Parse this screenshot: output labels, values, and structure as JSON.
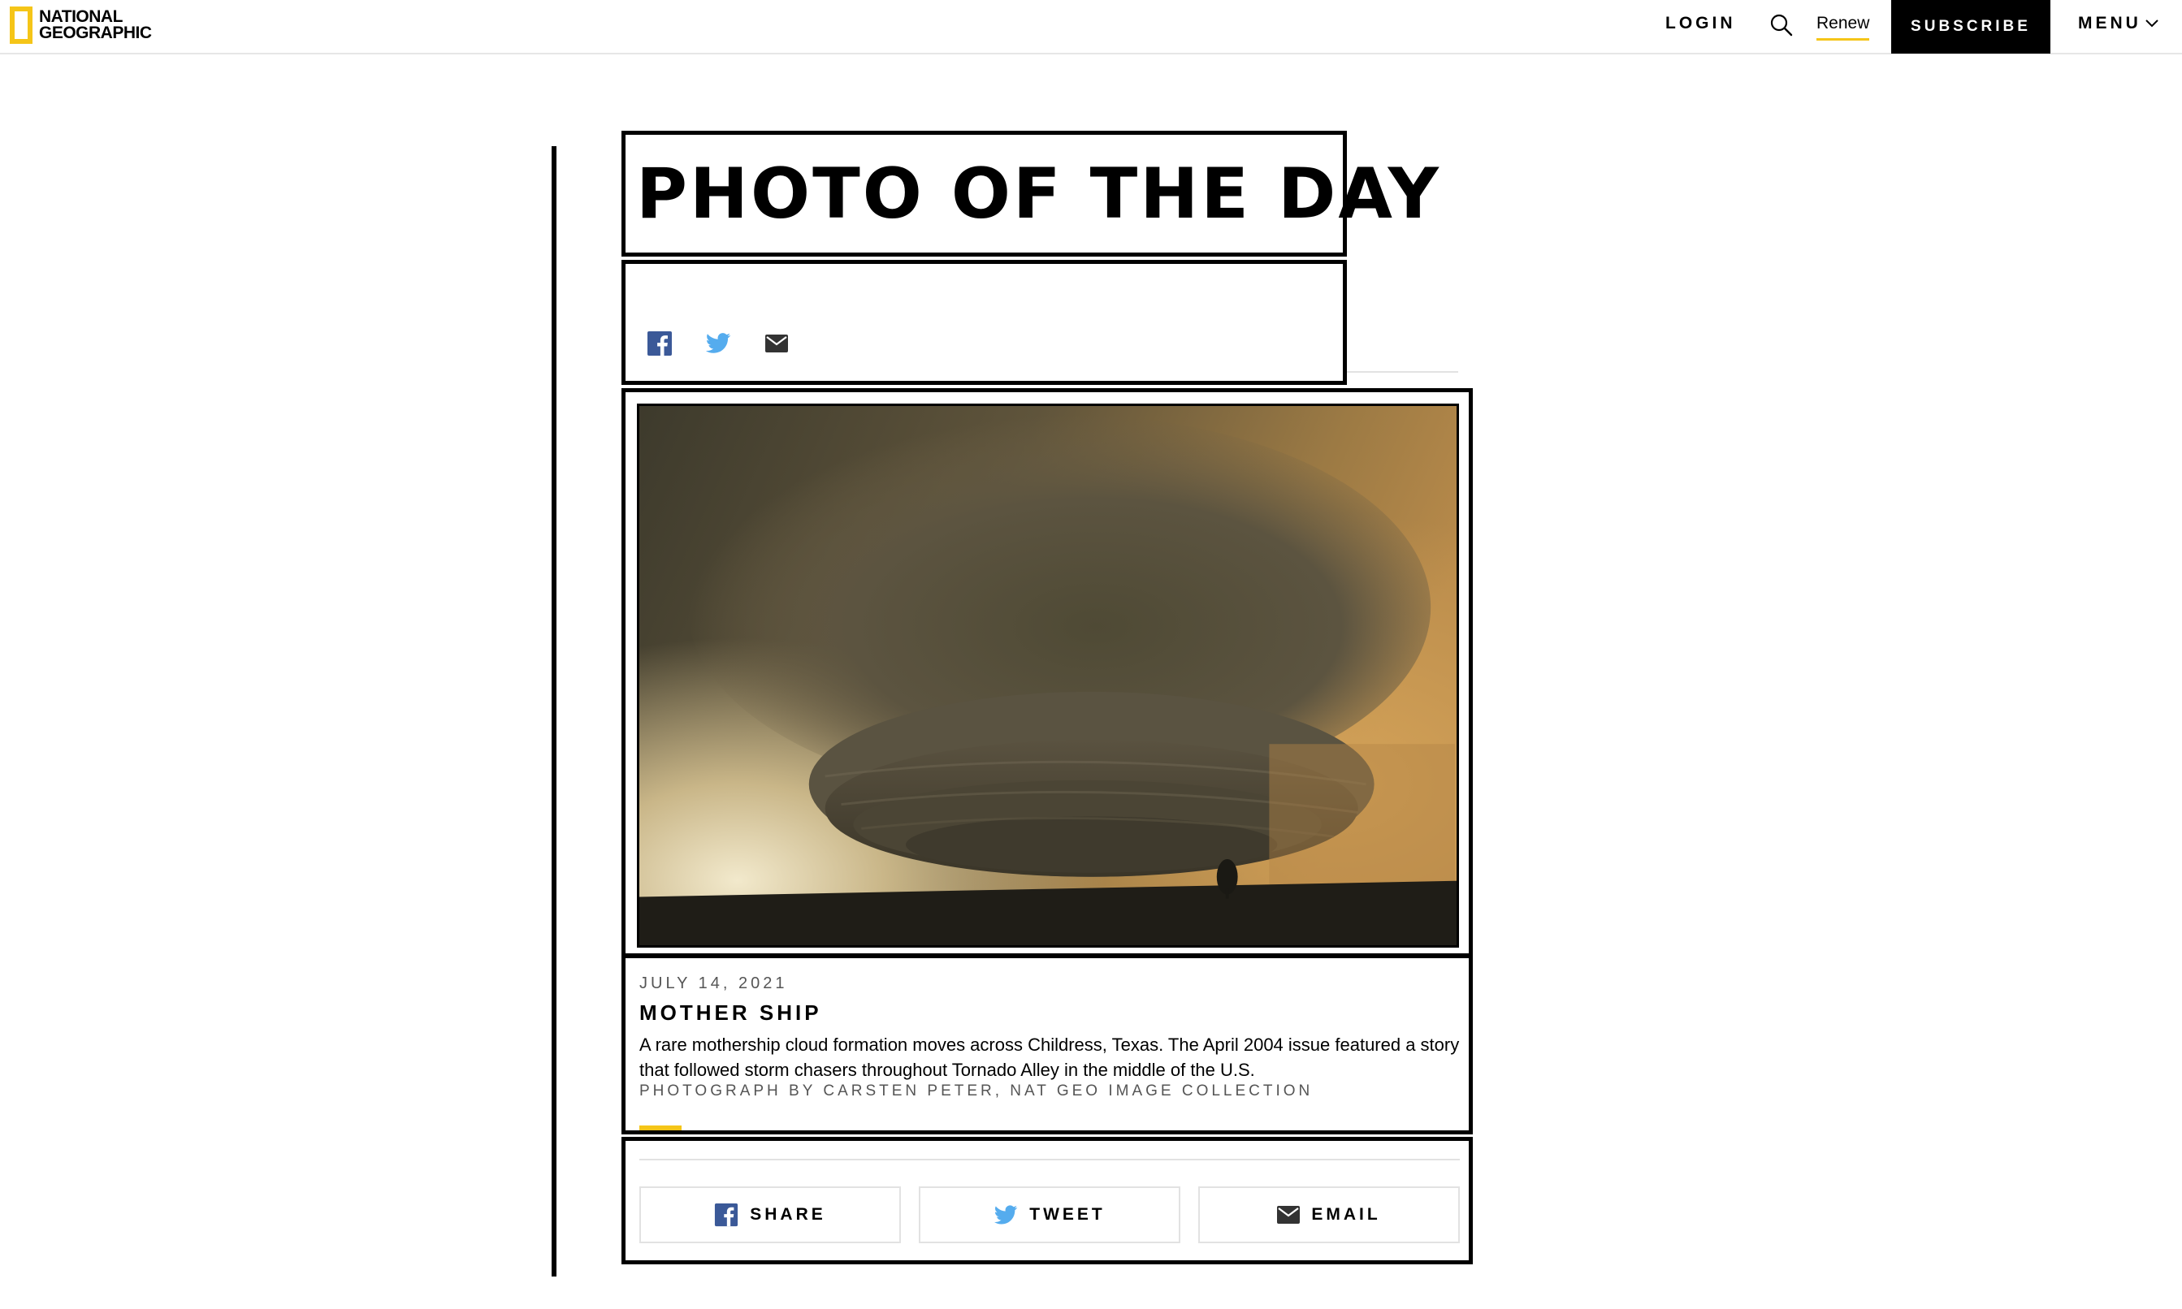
{
  "header": {
    "logo_line1": "NATIONAL",
    "logo_line2": "GEOGRAPHIC",
    "login_label": "LOGIN",
    "search_icon": "search-icon",
    "renew_label": "Renew",
    "subscribe_label": "SUBSCRIBE",
    "menu_label": "MENU"
  },
  "page": {
    "title": "PHOTO OF THE DAY"
  },
  "social_icons": [
    "facebook-icon",
    "twitter-icon",
    "email-icon"
  ],
  "photo": {
    "alt_subject": "supercell mothership cloud over plains with lone tree"
  },
  "caption": {
    "date": "JULY 14, 2021",
    "title": "MOTHER SHIP",
    "description": "A rare mothership cloud formation moves across Childress, Texas. The April 2004 issue featured a story that followed storm chasers throughout Tornado Alley in the middle of the U.S.",
    "credit": "PHOTOGRAPH BY CARSTEN PETER, NAT GEO IMAGE COLLECTION"
  },
  "share": {
    "share_label": "SHARE",
    "tweet_label": "TWEET",
    "email_label": "EMAIL"
  },
  "colors": {
    "accent_yellow": "#f5c518",
    "facebook_blue": "#3b5998",
    "twitter_blue": "#55acee",
    "black": "#000000"
  }
}
